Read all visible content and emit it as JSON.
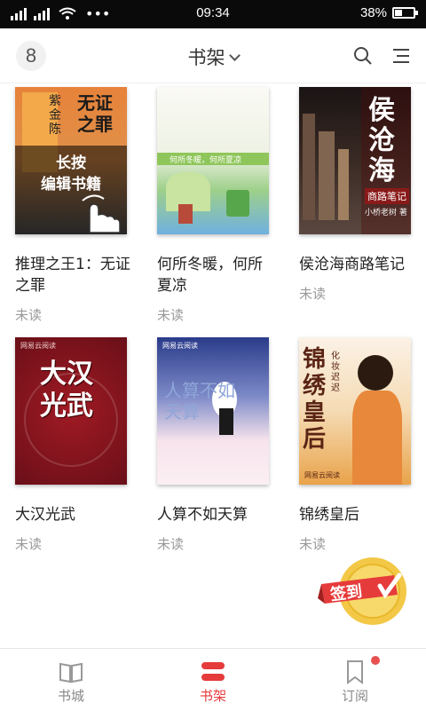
{
  "status_bar": {
    "time": "09:34",
    "battery": "38%",
    "battery_level": 0.38
  },
  "header": {
    "title": "书架",
    "avatar_glyph": "8"
  },
  "books": [
    {
      "title": "推理之王1：无证之罪",
      "status": "未读",
      "cover_text": [
        "无证",
        "之罪"
      ],
      "cover_author": "紫金陈",
      "overlay": [
        "长按",
        "编辑书籍"
      ],
      "accent": "#e7823a"
    },
    {
      "title": "何所冬暖，何所夏凉",
      "status": "未读",
      "cover_text": [
        "何所冬暖，何所夏凉"
      ],
      "accent": "#8fc65b"
    },
    {
      "title": "侯沧海商路笔记",
      "status": "未读",
      "cover_text": [
        "侯沧海",
        "商路笔记"
      ],
      "cover_author": "小桥老树 著",
      "accent": "#8a1a1a"
    },
    {
      "title": "大汉光武",
      "status": "未读",
      "cover_text": [
        "大汉光武"
      ],
      "accent": "#7a1420"
    },
    {
      "title": "人算不如天算",
      "status": "未读",
      "cover_text": [
        "人算不如天算"
      ],
      "accent": "#f4a7c0"
    },
    {
      "title": "锦绣皇后",
      "status": "未读",
      "cover_text": [
        "锦绣皇后"
      ],
      "cover_author": "化妆迟迟",
      "accent": "#e9a34a"
    }
  ],
  "publisher_tag": "网易云阅读",
  "signin": {
    "label": "签到"
  },
  "tabbar": {
    "tabs": [
      {
        "label": "书城",
        "icon": "book-open-icon"
      },
      {
        "label": "书架",
        "icon": "shelf-icon",
        "active": true
      },
      {
        "label": "订阅",
        "icon": "bookmark-icon",
        "badge": true
      }
    ]
  },
  "colors": {
    "accent": "#e63b3b",
    "badge": "#e85050",
    "gold": "#f3c847"
  }
}
